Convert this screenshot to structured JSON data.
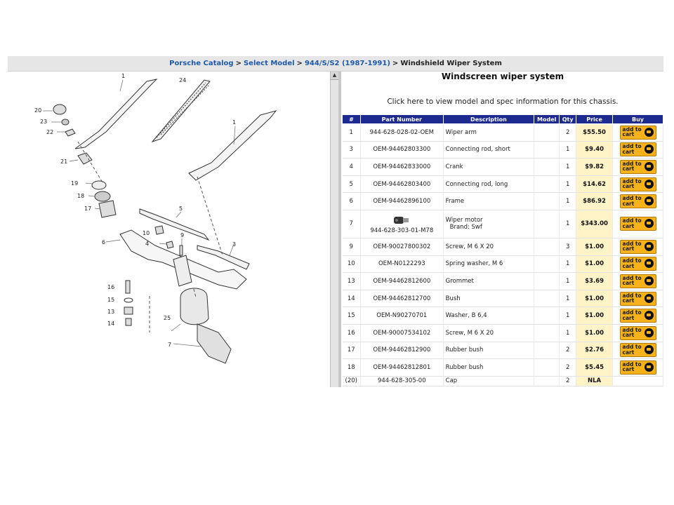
{
  "breadcrumb": {
    "items": [
      "Porsche Catalog",
      "Select Model",
      "944/S/S2 (1987-1991)"
    ],
    "current": "Windshield Wiper System",
    "separator": ">"
  },
  "diagram": {
    "callouts": [
      "1",
      "24",
      "20",
      "23",
      "22",
      "1",
      "21",
      "19",
      "18",
      "17",
      "5",
      "10",
      "9",
      "4",
      "6",
      "3",
      "16",
      "15",
      "13",
      "14",
      "25",
      "7"
    ]
  },
  "scrollbar": {
    "up_arrow": "▲"
  },
  "right": {
    "title": "Windscreen wiper system",
    "info_link": "Click here to view model and spec information for this chassis."
  },
  "table": {
    "headers": [
      "#",
      "Part Number",
      "Description",
      "Model",
      "Qty",
      "Price",
      "Buy"
    ],
    "add_to_cart_line1": "add to",
    "add_to_cart_line2": "cart",
    "rows": [
      {
        "num": "1",
        "part": "944-628-028-02-OEM",
        "desc": "Wiper arm",
        "desc2": "",
        "model": "",
        "qty": "2",
        "price": "$55.50",
        "buy": true
      },
      {
        "num": "3",
        "part": "OEM-94462803300",
        "desc": "Connecting rod, short",
        "desc2": "",
        "model": "",
        "qty": "1",
        "price": "$9.40",
        "buy": true
      },
      {
        "num": "4",
        "part": "OEM-94462833000",
        "desc": "Crank",
        "desc2": "",
        "model": "",
        "qty": "1",
        "price": "$9.82",
        "buy": true
      },
      {
        "num": "5",
        "part": "OEM-94462803400",
        "desc": "Connecting rod, long",
        "desc2": "",
        "model": "",
        "qty": "1",
        "price": "$14.62",
        "buy": true
      },
      {
        "num": "6",
        "part": "OEM-94462896100",
        "desc": "Frame",
        "desc2": "",
        "model": "",
        "qty": "1",
        "price": "$86.92",
        "buy": true
      },
      {
        "num": "7",
        "part": "944-628-303-01-M78",
        "desc": "Wiper motor",
        "desc2": "Brand: Swf",
        "model": "",
        "qty": "1",
        "price": "$343.00",
        "buy": true,
        "image": true
      },
      {
        "num": "9",
        "part": "OEM-90027800302",
        "desc": "Screw, M 6 X 20",
        "desc2": "",
        "model": "",
        "qty": "3",
        "price": "$1.00",
        "buy": true
      },
      {
        "num": "10",
        "part": "OEM-N0122293",
        "desc": "Spring washer, M 6",
        "desc2": "",
        "model": "",
        "qty": "1",
        "price": "$1.00",
        "buy": true
      },
      {
        "num": "13",
        "part": "OEM-94462812600",
        "desc": "Grommet",
        "desc2": "",
        "model": "",
        "qty": "1",
        "price": "$3.69",
        "buy": true
      },
      {
        "num": "14",
        "part": "OEM-94462812700",
        "desc": "Bush",
        "desc2": "",
        "model": "",
        "qty": "1",
        "price": "$1.00",
        "buy": true
      },
      {
        "num": "15",
        "part": "OEM-N90270701",
        "desc": "Washer, B 6,4",
        "desc2": "",
        "model": "",
        "qty": "1",
        "price": "$1.00",
        "buy": true
      },
      {
        "num": "16",
        "part": "OEM-90007534102",
        "desc": "Screw, M 6 X 20",
        "desc2": "",
        "model": "",
        "qty": "1",
        "price": "$1.00",
        "buy": true
      },
      {
        "num": "17",
        "part": "OEM-94462812900",
        "desc": "Rubber bush",
        "desc2": "",
        "model": "",
        "qty": "2",
        "price": "$2.76",
        "buy": true
      },
      {
        "num": "18",
        "part": "OEM-94462812801",
        "desc": "Rubber bush",
        "desc2": "",
        "model": "",
        "qty": "2",
        "price": "$5.45",
        "buy": true
      },
      {
        "num": "(20)",
        "part": "944-628-305-00",
        "desc": "Cap",
        "desc2": "",
        "model": "",
        "qty": "2",
        "price": "NLA",
        "buy": false
      }
    ]
  },
  "colors": {
    "header_blue": "#1d2b91",
    "link_blue": "#1e5aa8",
    "price_bg": "#fff3c8",
    "cart_orange": "#f6b21b"
  }
}
